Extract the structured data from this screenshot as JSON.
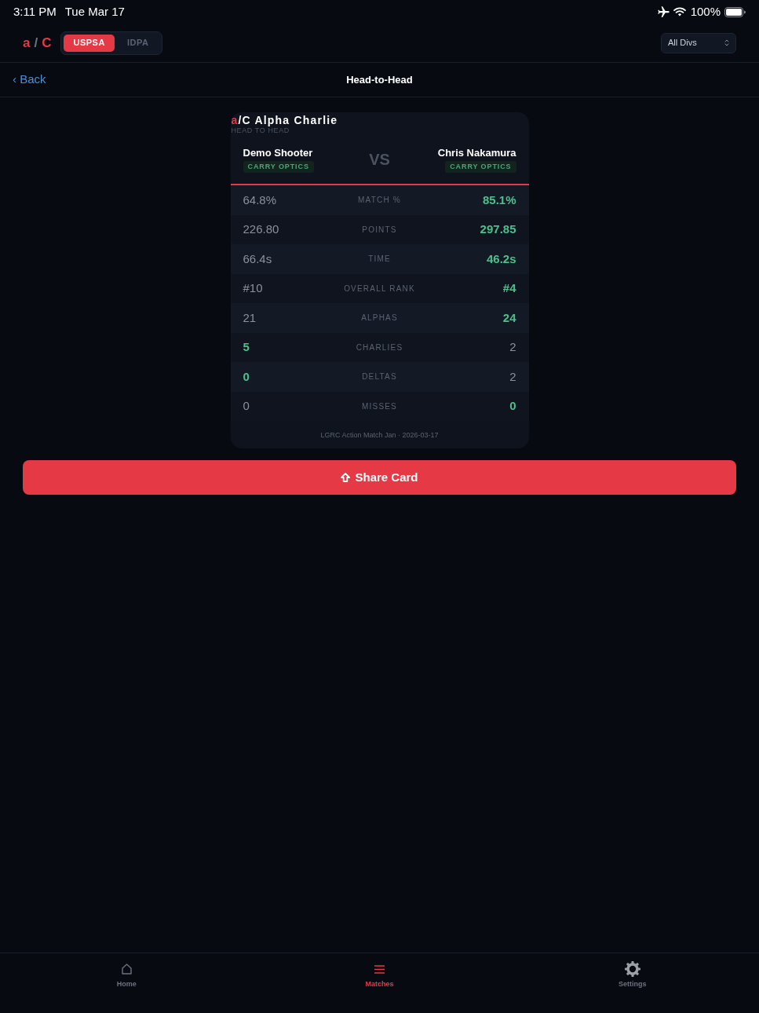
{
  "status_bar": {
    "time": "3:11 PM",
    "date": "Tue Mar 17",
    "battery": "100%"
  },
  "header": {
    "logo": [
      {
        "text": "a",
        "kind": "accent"
      },
      {
        "text": "/",
        "kind": "separator"
      },
      {
        "text": "C",
        "kind": "accent"
      }
    ],
    "sport_tabs": [
      {
        "label": "USPSA",
        "selected": true
      },
      {
        "label": "IDPA",
        "selected": false
      }
    ],
    "division_select": {
      "value": "All Divs"
    }
  },
  "nav": {
    "back": "‹ Back",
    "title": "Head-to-Head"
  },
  "card": {
    "brand": {
      "mark": "a",
      "name": "/C Alpha Charlie"
    },
    "subtitle": "HEAD TO HEAD",
    "competitors": [
      {
        "name": "Demo Shooter",
        "division": "CARRY OPTICS"
      },
      {
        "name": "Chris Nakamura",
        "division": "CARRY OPTICS"
      }
    ],
    "versus": "VS",
    "rows": [
      {
        "label": "MATCH %",
        "left": {
          "value": "64.8%",
          "best": false
        },
        "right": {
          "value": "85.1%",
          "best": true
        }
      },
      {
        "label": "POINTS",
        "left": {
          "value": "226.80",
          "best": false
        },
        "right": {
          "value": "297.85",
          "best": true
        }
      },
      {
        "label": "TIME",
        "left": {
          "value": "66.4s",
          "best": false
        },
        "right": {
          "value": "46.2s",
          "best": true
        }
      },
      {
        "label": "OVERALL RANK",
        "left": {
          "value": "#10",
          "best": false
        },
        "right": {
          "value": "#4",
          "best": true
        }
      },
      {
        "label": "ALPHAS",
        "left": {
          "value": "21",
          "best": false
        },
        "right": {
          "value": "24",
          "best": true
        }
      },
      {
        "label": "CHARLIES",
        "left": {
          "value": "5",
          "best": true
        },
        "right": {
          "value": "2",
          "best": false
        }
      },
      {
        "label": "DELTAS",
        "left": {
          "value": "0",
          "best": true
        },
        "right": {
          "value": "2",
          "best": false
        }
      },
      {
        "label": "MISSES",
        "left": {
          "value": "0",
          "best": false
        },
        "right": {
          "value": "0",
          "best": true
        }
      }
    ],
    "footer": "LGRC Action Match Jan · 2026-03-17"
  },
  "share_button": {
    "label": "Share Card"
  },
  "tab_bar": [
    {
      "label": "Home",
      "kind": "home",
      "selected": false
    },
    {
      "label": "Matches",
      "kind": "matches",
      "selected": true
    },
    {
      "label": "Settings",
      "kind": "settings",
      "selected": false
    }
  ]
}
